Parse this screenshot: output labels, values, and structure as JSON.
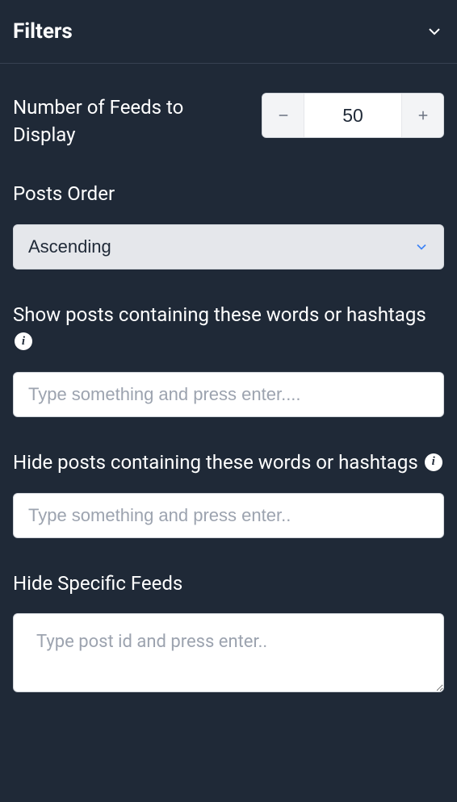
{
  "header": {
    "title": "Filters"
  },
  "fields": {
    "numFeeds": {
      "label": "Number of Feeds to Display",
      "value": "50"
    },
    "postsOrder": {
      "label": "Posts Order",
      "selected": "Ascending"
    },
    "showWords": {
      "label": "Show posts containing these words or hashtags",
      "placeholder": "Type something and press enter....",
      "infoGlyph": "i"
    },
    "hideWords": {
      "label": "Hide posts containing these words or hashtags",
      "placeholder": "Type something and press enter..",
      "infoGlyph": "i"
    },
    "hideFeeds": {
      "label": "Hide Specific Feeds",
      "placeholder": "Type post id and press enter.."
    }
  }
}
